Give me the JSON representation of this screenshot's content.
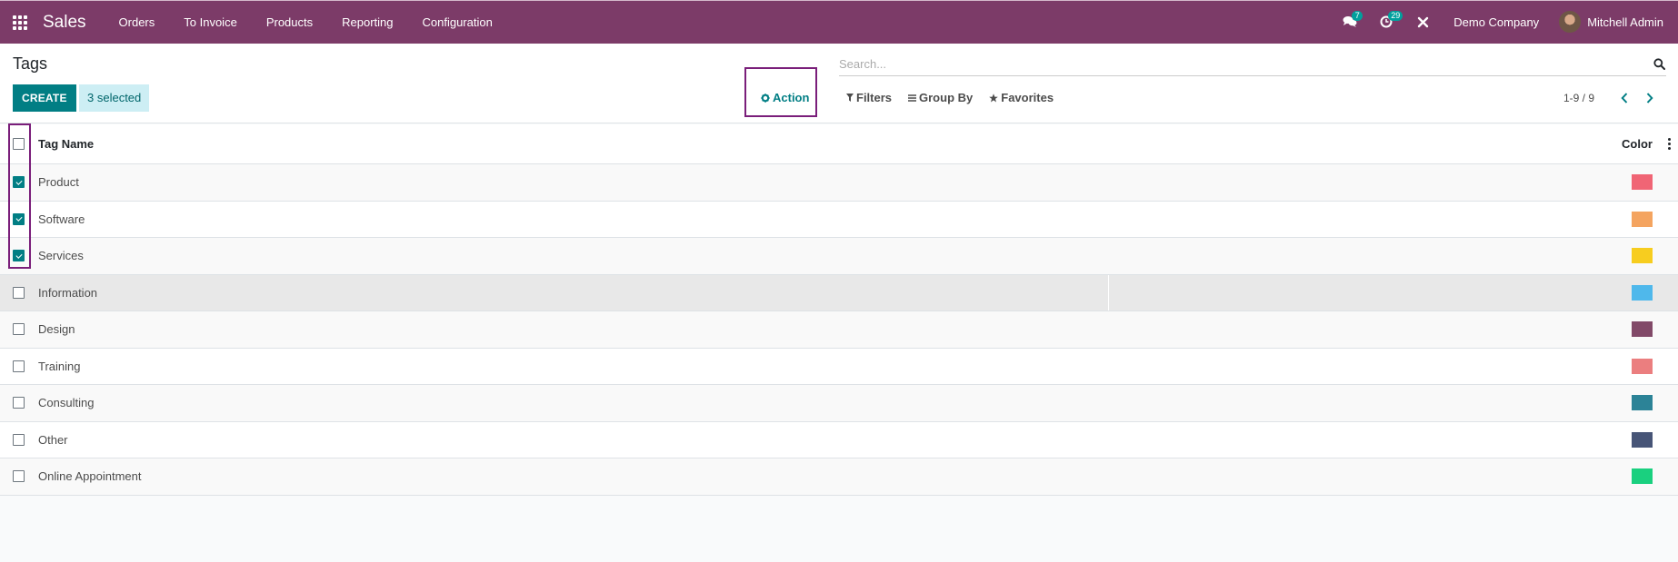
{
  "navbar": {
    "brand": "Sales",
    "menu": [
      "Orders",
      "To Invoice",
      "Products",
      "Reporting",
      "Configuration"
    ],
    "messages_badge": "7",
    "activities_badge": "29",
    "company": "Demo Company",
    "user": "Mitchell Admin",
    "icons": {
      "apps": "grid-icon",
      "messages": "chat-bubbles-icon",
      "activities": "clock-icon",
      "debug": "tools-icon"
    }
  },
  "control_panel": {
    "breadcrumb": "Tags",
    "create_label": "CREATE",
    "selected_label": "3 selected",
    "action_label": "Action",
    "search_placeholder": "Search...",
    "filters_label": "Filters",
    "group_by_label": "Group By",
    "favorites_label": "Favorites",
    "pager_value": "1-9 / 9"
  },
  "list": {
    "columns": {
      "name": "Tag Name",
      "color": "Color"
    },
    "rows": [
      {
        "name": "Product",
        "color": "#f06575",
        "checked": true
      },
      {
        "name": "Software",
        "color": "#f4a460",
        "checked": true
      },
      {
        "name": "Services",
        "color": "#f7cd1f",
        "checked": true
      },
      {
        "name": "Information",
        "color": "#4fb8eb",
        "checked": false
      },
      {
        "name": "Design",
        "color": "#814968",
        "checked": false
      },
      {
        "name": "Training",
        "color": "#eb7e7f",
        "checked": false
      },
      {
        "name": "Consulting",
        "color": "#2c8397",
        "checked": false
      },
      {
        "name": "Other",
        "color": "#475577",
        "checked": false
      },
      {
        "name": "Online Appointment",
        "color": "#1ad07f",
        "checked": false
      }
    ]
  },
  "colors": {
    "brand": "#7c3b68",
    "primary": "#017e84",
    "highlight_box": "#7a1e7a"
  }
}
